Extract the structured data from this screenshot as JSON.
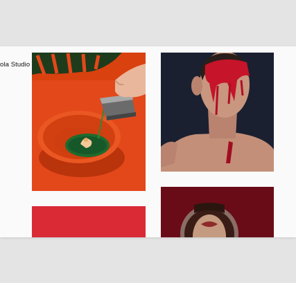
{
  "site": {
    "brand_name": "ola Studio"
  },
  "gallery": {
    "tiles": [
      {
        "subject": "green-soup-plating-photo",
        "accent": "#e04a16"
      },
      {
        "subject": "red-paint-face-portrait-photo",
        "accent": "#1b2230"
      },
      {
        "subject": "red-solid-photo",
        "accent": "#d82a36"
      },
      {
        "subject": "round-mirror-lips-photo",
        "accent": "#6b0d18"
      }
    ]
  }
}
